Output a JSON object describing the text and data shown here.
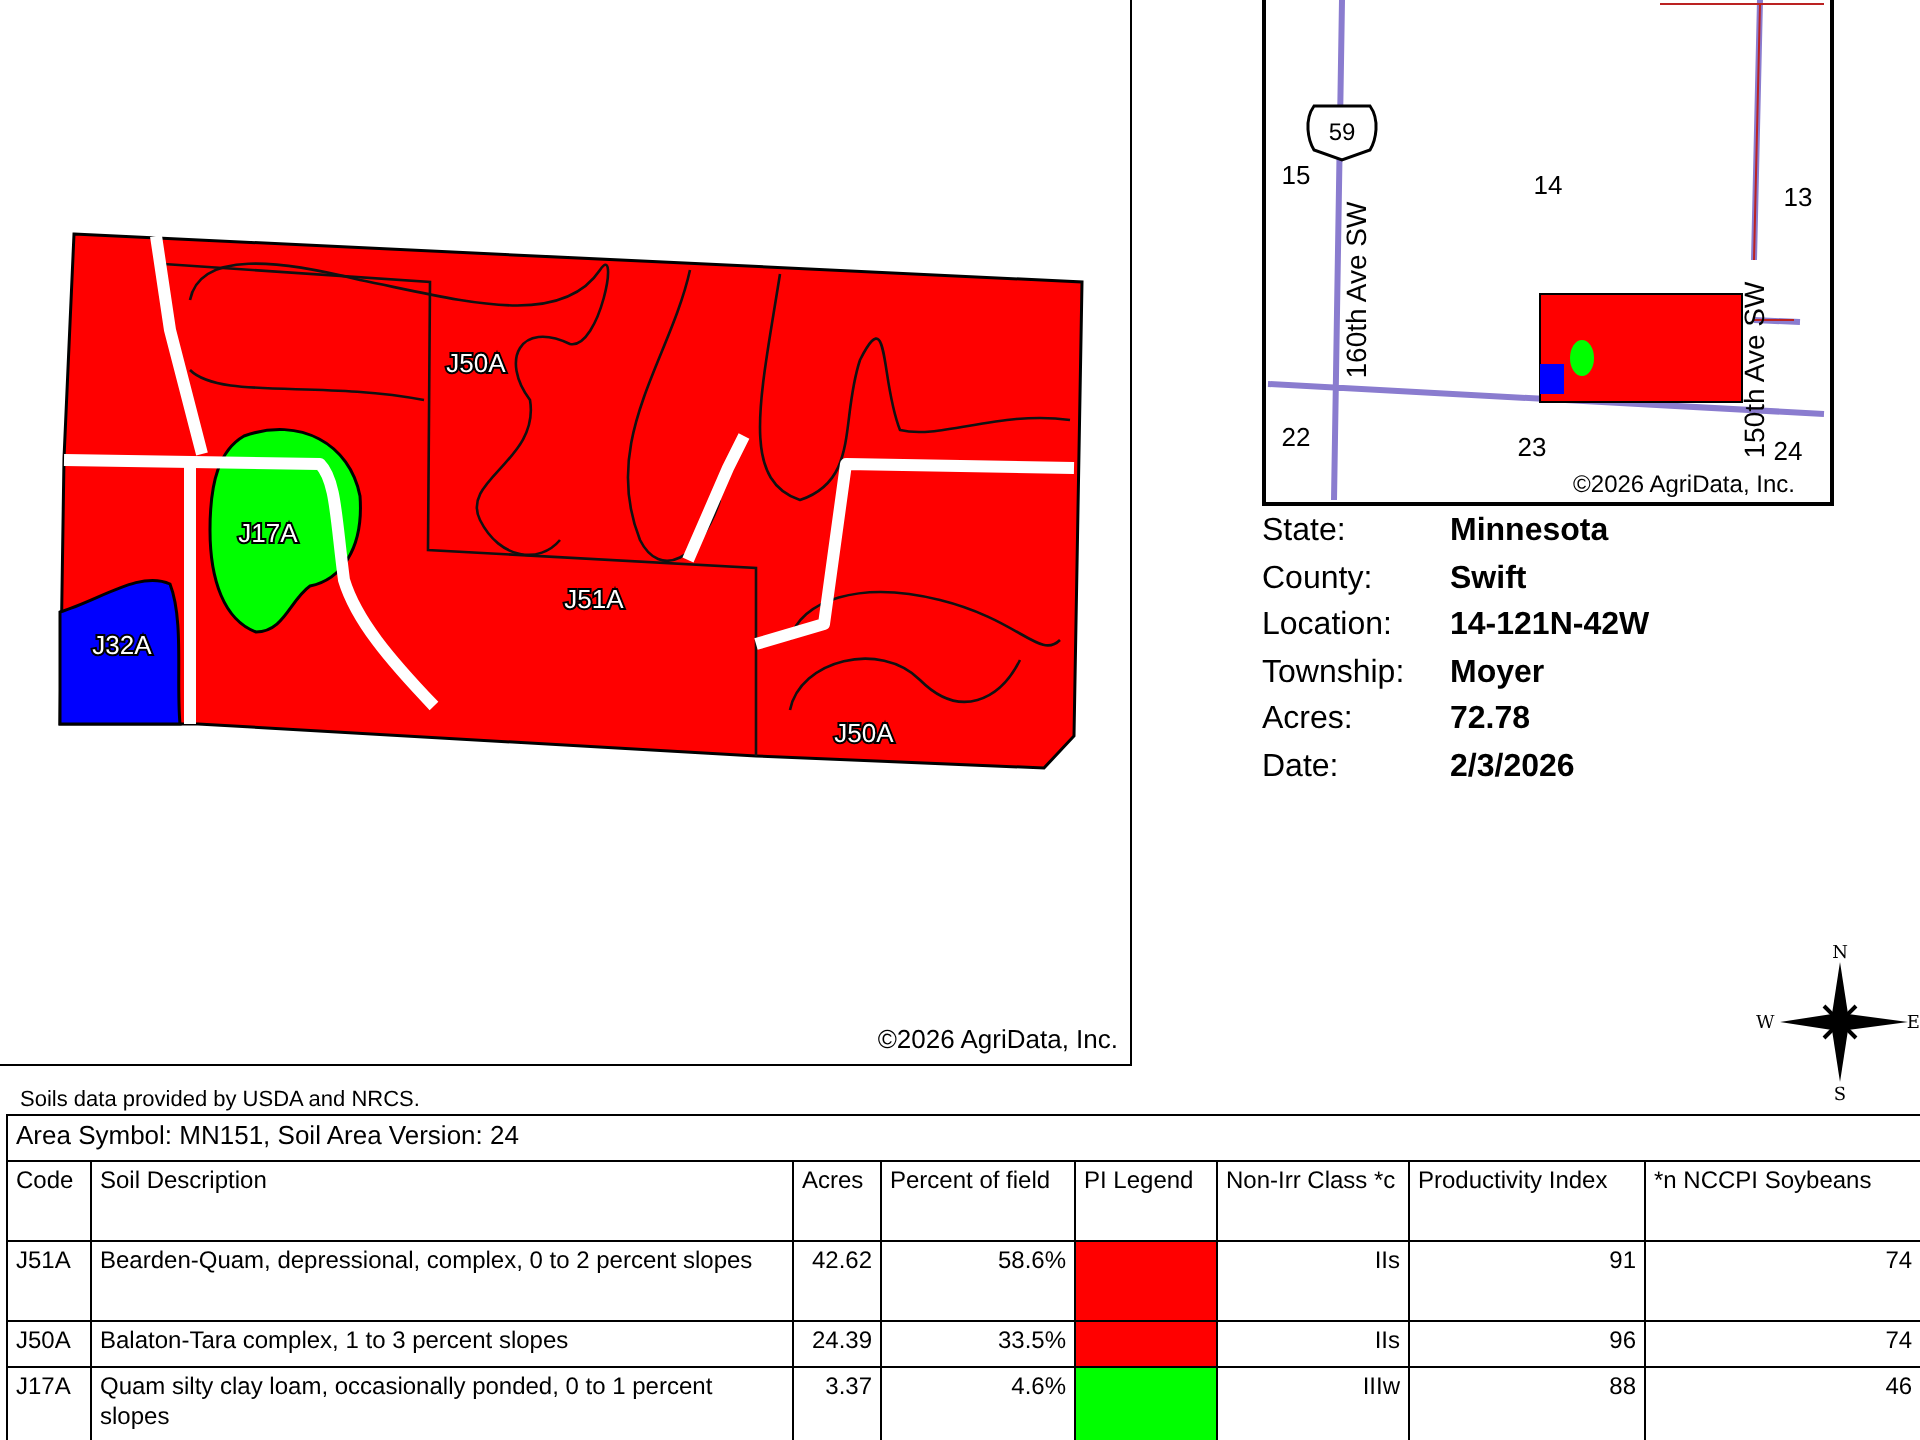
{
  "field_map": {
    "labels": [
      "J50A",
      "J17A",
      "J51A",
      "J32A",
      "J50A"
    ],
    "copyright": "©2026 AgriData, Inc."
  },
  "inset_map": {
    "route": "59",
    "sections": [
      "15",
      "14",
      "13",
      "22",
      "23",
      "24"
    ],
    "roads": [
      "160th Ave SW",
      "150th Ave SW"
    ],
    "copyright": "©2026 AgriData, Inc."
  },
  "info": [
    {
      "label": "State:",
      "value": "Minnesota"
    },
    {
      "label": "County:",
      "value": "Swift"
    },
    {
      "label": "Location:",
      "value": "14-121N-42W"
    },
    {
      "label": "Township:",
      "value": "Moyer"
    },
    {
      "label": "Acres:",
      "value": "72.78"
    },
    {
      "label": "Date:",
      "value": "2/3/2026"
    }
  ],
  "compass": [
    "N",
    "E",
    "S",
    "W"
  ],
  "source_note": "Soils data provided by USDA and NRCS.",
  "table": {
    "title": "Area Symbol: MN151, Soil Area Version: 24",
    "columns": [
      "Code",
      "Soil Description",
      "Acres",
      "Percent of field",
      "PI Legend",
      "Non-Irr Class *c",
      "Productivity Index",
      "*n NCCPI Soybeans"
    ],
    "rows": [
      {
        "code": "J51A",
        "description": "Bearden-Quam, depressional, complex, 0 to 2 percent slopes",
        "acres": "42.62",
        "percent": "58.6%",
        "color": "#ff0000",
        "class": "IIs",
        "pi": "91",
        "nccpi": "74"
      },
      {
        "code": "J50A",
        "description": "Balaton-Tara complex, 1 to 3 percent slopes",
        "acres": "24.39",
        "percent": "33.5%",
        "color": "#ff0000",
        "class": "IIs",
        "pi": "96",
        "nccpi": "74"
      },
      {
        "code": "J17A",
        "description": "Quam silty clay loam, occasionally ponded, 0 to 1 percent slopes",
        "acres": "3.37",
        "percent": "4.6%",
        "color": "#00ff00",
        "class": "IIIw",
        "pi": "88",
        "nccpi": "46"
      }
    ]
  }
}
